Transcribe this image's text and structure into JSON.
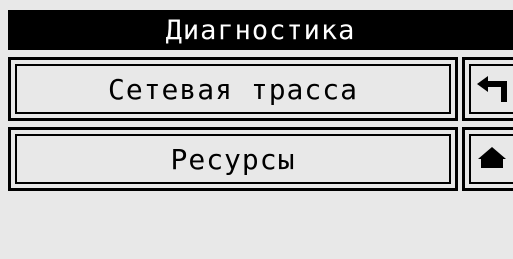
{
  "header": {
    "title": "Диагностика"
  },
  "menu": {
    "items": [
      {
        "label": "Сетевая трасса"
      },
      {
        "label": "Ресурсы"
      }
    ]
  },
  "side_buttons": {
    "back_icon": "return-arrow-icon",
    "home_icon": "home-icon"
  },
  "colors": {
    "background": "#e8e8e8",
    "ink": "#000000",
    "header_text": "#ffffff"
  }
}
